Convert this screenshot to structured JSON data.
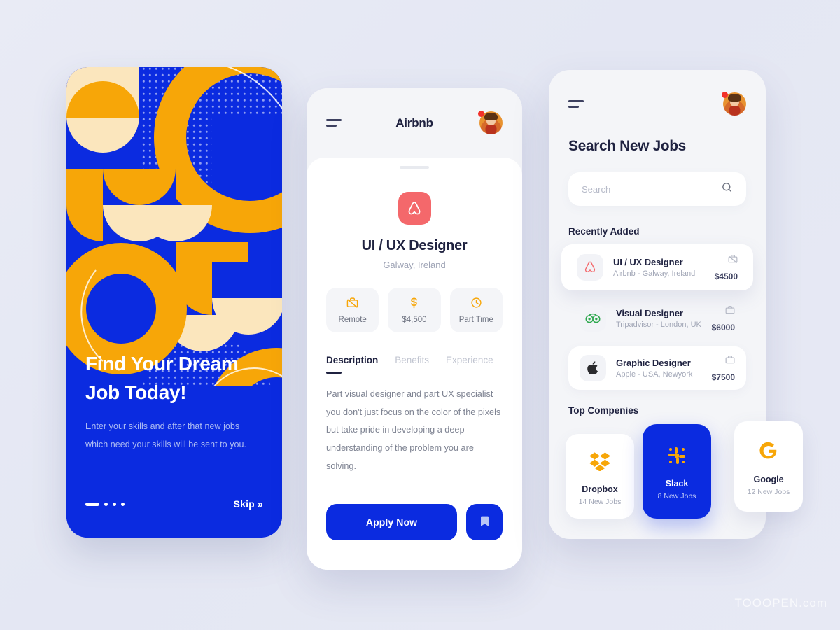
{
  "onboarding": {
    "title_line1": "Find Your Dream",
    "title_line2": "Job Today!",
    "subtitle_line1": "Enter your skills and after that new jobs",
    "subtitle_line2": "which need your skills will be sent to you.",
    "skip_label": "Skip »",
    "accent_blue": "#0b2be0",
    "accent_orange": "#f7a608",
    "accent_cream": "#fbe6bd"
  },
  "detail": {
    "header_title": "Airbnb",
    "menu_icon": "hamburger-icon",
    "avatar_icon": "user-avatar",
    "company_logo_icon": "airbnb-logo",
    "job_title": "UI / UX Designer",
    "location": "Galway, Ireland",
    "chips": [
      {
        "icon": "briefcase-off-icon",
        "label": "Remote"
      },
      {
        "icon": "dollar-icon",
        "label": "$4,500"
      },
      {
        "icon": "clock-icon",
        "label": "Part Time"
      }
    ],
    "tabs": [
      {
        "label": "Description",
        "active": true
      },
      {
        "label": "Benefits",
        "active": false
      },
      {
        "label": "Experience",
        "active": false
      }
    ],
    "description": "Part visual designer and part UX specialist you don't just focus on the color of the pixels but take pride in developing a deep understanding of the problem you are solving.",
    "apply_label": "Apply Now",
    "bookmark_icon": "bookmark-icon"
  },
  "search": {
    "menu_icon": "hamburger-icon",
    "avatar_icon": "user-avatar",
    "page_title": "Search New Jobs",
    "search_placeholder": "Search",
    "search_value": "",
    "search_icon": "search-icon",
    "recently_added_label": "Recently Added",
    "jobs": [
      {
        "logo": "airbnb-logo",
        "title": "UI / UX Designer",
        "meta": "Airbnb - Galway, Ireland",
        "pay": "$4500",
        "type_icon": "briefcase-off-icon",
        "featured": true
      },
      {
        "logo": "tripadvisor-logo",
        "title": "Visual Designer",
        "meta": "Tripadvisor - London, UK",
        "pay": "$6000",
        "type_icon": "briefcase-icon",
        "featured": false
      },
      {
        "logo": "apple-logo",
        "title": "Graphic Designer",
        "meta": "Apple - USA, Newyork",
        "pay": "$7500",
        "type_icon": "briefcase-icon",
        "featured": false
      }
    ],
    "top_companies_label": "Top Compenies",
    "companies": [
      {
        "logo": "dropbox-logo",
        "name": "Dropbox",
        "jobs": "14 New Jobs",
        "highlighted": false
      },
      {
        "logo": "slack-logo",
        "name": "Slack",
        "jobs": "8 New Jobs",
        "highlighted": true
      },
      {
        "logo": "google-logo",
        "name": "Google",
        "jobs": "12 New Jobs",
        "highlighted": false
      }
    ]
  },
  "watermark": "TOOOPEN.com"
}
